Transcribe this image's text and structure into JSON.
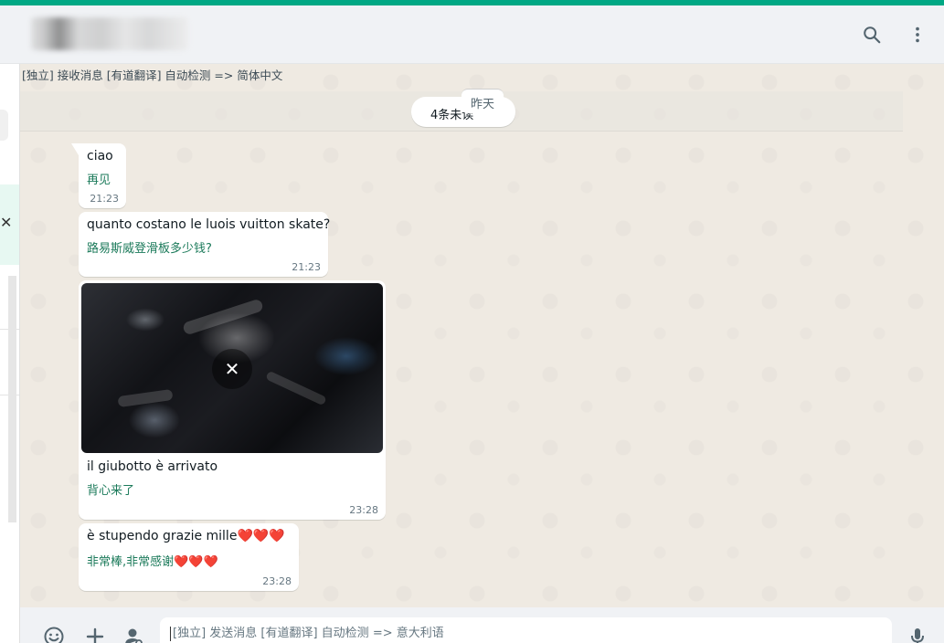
{
  "header": {
    "search_icon": "search-icon",
    "menu_icon": "more-vertical-icon"
  },
  "translation_bar": {
    "text": "[独立] 接收消息 [有道翻译] 自动检测 => 简体中文"
  },
  "unread": {
    "label": "4条未读",
    "date_label": "昨天"
  },
  "messages": [
    {
      "original": "ciao",
      "translation": "再见",
      "time": "21:23"
    },
    {
      "original": "quanto costano le luois vuitton skate?",
      "translation": "路易斯威登滑板多少钱?",
      "time": "21:23"
    },
    {
      "image_icon": "close-icon",
      "original": "il giubotto è arrivato",
      "translation": "背心来了",
      "time": "23:28"
    },
    {
      "original": "è stupendo grazie mille❤️❤️❤️",
      "translation": "非常棒,非常感谢❤️❤️❤️",
      "time": "23:28"
    }
  ],
  "composer": {
    "placeholder": "[独立] 发送消息 [有道翻译] 自动检测 => 意大利语",
    "emoji_icon": "emoji-icon",
    "attach_icon": "plus-icon",
    "sticker_icon": "contact-icon",
    "mic_icon": "microphone-icon"
  },
  "colors": {
    "accent": "#00a884",
    "chat_bg": "#efeae2",
    "translation_text": "#1b7a5a"
  }
}
